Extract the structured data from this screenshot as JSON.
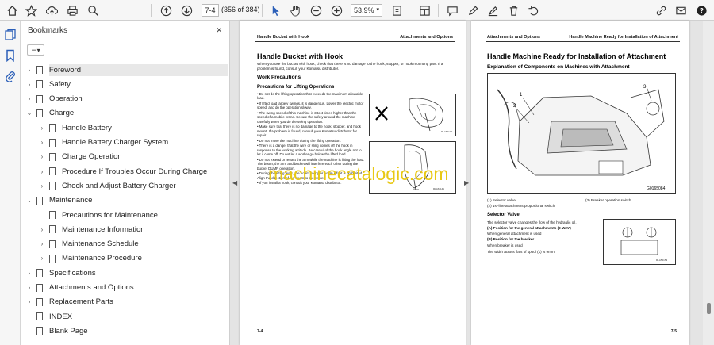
{
  "toolbar": {
    "page_input": "7-4",
    "page_count": "(356 of 384)",
    "zoom": "53.9%"
  },
  "bookmarks_panel": {
    "title": "Bookmarks",
    "close": "×",
    "options_icon": "options-menu-icon",
    "items": [
      {
        "label": "Foreword",
        "level": 0,
        "twisty": "›",
        "selected": true
      },
      {
        "label": "Safety",
        "level": 0,
        "twisty": "›"
      },
      {
        "label": "Operation",
        "level": 0,
        "twisty": "›"
      },
      {
        "label": "Charge",
        "level": 0,
        "twisty": "⌄"
      },
      {
        "label": "Handle Battery",
        "level": 1,
        "twisty": "›"
      },
      {
        "label": "Handle Battery Charger System",
        "level": 1,
        "twisty": "›"
      },
      {
        "label": "Charge Operation",
        "level": 1,
        "twisty": "›"
      },
      {
        "label": "Procedure If Troubles Occur During Charge",
        "level": 1,
        "twisty": "›"
      },
      {
        "label": "Check and Adjust Battery Charger",
        "level": 1,
        "twisty": "›"
      },
      {
        "label": "Maintenance",
        "level": 0,
        "twisty": "⌄"
      },
      {
        "label": "Precautions for Maintenance",
        "level": 1,
        "twisty": ""
      },
      {
        "label": "Maintenance Information",
        "level": 1,
        "twisty": "›"
      },
      {
        "label": "Maintenance Schedule",
        "level": 1,
        "twisty": "›"
      },
      {
        "label": "Maintenance Procedure",
        "level": 1,
        "twisty": "›"
      },
      {
        "label": "Specifications",
        "level": 0,
        "twisty": "›"
      },
      {
        "label": "Attachments and Options",
        "level": 0,
        "twisty": "›"
      },
      {
        "label": "Replacement Parts",
        "level": 0,
        "twisty": "›"
      },
      {
        "label": "INDEX",
        "level": 0,
        "twisty": ""
      },
      {
        "label": "Blank Page",
        "level": 0,
        "twisty": ""
      }
    ]
  },
  "page_left": {
    "header_left": "Handle Bucket with Hook",
    "header_right": "Attachments and Options",
    "title": "Handle Bucket with Hook",
    "intro": "When you use the bucket with hook, check that there is no damage to the hook, stopper, or hook mounting part. If a problem is found, consult your Komatsu distributor.",
    "section": "Work Precautions",
    "subsection": "Precautions for Lifting Operations",
    "bullets": [
      "• Do not do the lifting operation that exceeds the maximum allowable load.",
      "• If lifted load largely swings, it is dangerous. Lower the electric motor speed, and do the operation slowly.",
      "• The swing speed of this machine is 3 to 4 times higher than the speed of a mobile crane. Secure the safety around the machine carefully when you do the swing operation.",
      "• Make sure that there is no damage to the hook, stopper, and hook mount. If a problem is found, consult your Komatsu distributor for repair.",
      "• Do not move the machine during the lifting operation.",
      "• There is a danger that the wire or sling comes off the hook in response to the working attitude. Be careful of the hook angle not to let it come off. Do not let a worker go below the lifted load.",
      "• Do not extend or retract the arm while the machine is lifting the load. The boom, the arm and bucket will interfere each other during the bucket DUMP operation.",
      "• During the lifting work, the boom swing or boom offset is prohibited. Align the direction of the boom to the center.",
      "• If you install a hook, consult your Komatsu distributor."
    ],
    "fig1_code": "RLA62170",
    "fig2_code": "RLA61141",
    "footer": "7-4"
  },
  "page_right": {
    "header_left": "Attachments and Options",
    "header_right": "Handle Machine Ready for Installation of Attachment",
    "title": "Handle Machine Ready for Installation of Attachment",
    "section": "Explanation of Components on Machines with Attachment",
    "fig_code": "G0165084",
    "callout1": "1",
    "callout2": "2",
    "callout3": "3",
    "legend1": "(1) Selector valve",
    "legend2": "(2) 1st-line attachment proportional switch",
    "legend3": "(3) Breaker operation switch",
    "subsection": "Selector Valve",
    "body1": "The selector valve changes the flow of the hydraulic oil.",
    "body2": "(A) Position for the general attachments (2-WAY)",
    "body3": "When general attachment is used",
    "body4": "(B) Position for the breaker",
    "body5": "When breaker is used",
    "body6": "The width across flats of spool (1) is 9mm.",
    "small_fig_code": "RLA52153",
    "footer": "7-5"
  },
  "watermark": "machinecatalogic.com",
  "colors": {
    "accent": "#2b5fb8",
    "watermark": "#e8c814"
  }
}
